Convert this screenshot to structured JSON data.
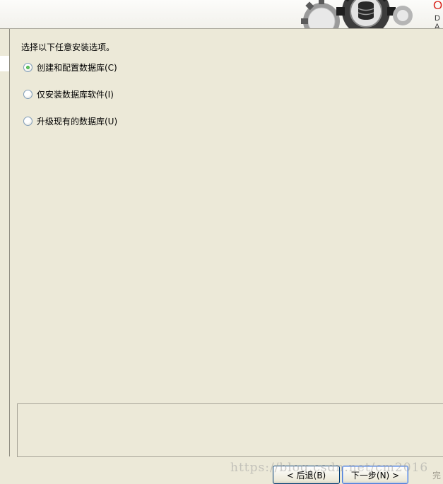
{
  "header": {
    "brand_top": "O",
    "brand_bottom": "D A"
  },
  "install_options": {
    "prompt": "选择以下任意安装选项。",
    "selected_index": 0,
    "items": [
      {
        "label": "创建和配置数据库(C)",
        "selected": true
      },
      {
        "label": "仅安装数据库软件(I)",
        "selected": false
      },
      {
        "label": "升级现有的数据库(U)",
        "selected": false
      }
    ]
  },
  "buttons": {
    "back": "< 后退(B)",
    "next": "下一步(N) >",
    "finish_partial": "完"
  },
  "watermark": "https://blog.csdn.net/cm2016",
  "colors": {
    "window_bg": "#ece9d8",
    "radio_selected": "#2e9a2e",
    "brand_red": "#d9231b",
    "button_border": "#003c74"
  }
}
